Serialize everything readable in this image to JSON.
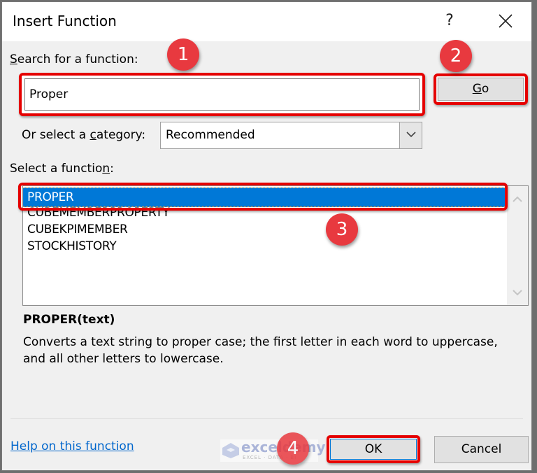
{
  "dialog": {
    "title": "Insert Function",
    "help_glyph": "?",
    "close_icon": "close-icon"
  },
  "search": {
    "label_underlined": "S",
    "label_rest": "earch for a function:",
    "value": "Proper",
    "go_label_underlined": "G",
    "go_label_rest": "o"
  },
  "category": {
    "label_prefix": "Or select a ",
    "label_underlined": "c",
    "label_rest": "ategory:",
    "selected": "Recommended",
    "arrow_icon": "chevron-down-icon"
  },
  "functions": {
    "label_prefix": "Select a functio",
    "label_underlined": "n",
    "label_rest": ":",
    "items": [
      "PROPER",
      "CUBEMEMBERPROPERTY",
      "CUBEKPIMEMBER",
      "STOCKHISTORY"
    ],
    "selected_index": 0
  },
  "details": {
    "signature": "PROPER(text)",
    "description": "Converts a text string to proper case; the first letter in each word to uppercase, and all other letters to lowercase."
  },
  "footer": {
    "help_link": "Help on this function",
    "ok_label": "OK",
    "cancel_label": "Cancel"
  },
  "watermark": {
    "name": "exceldemy",
    "tagline": "EXCEL · DATA · BI"
  },
  "annotations": {
    "step1": "1",
    "step2": "2",
    "step3": "3",
    "step4": "4",
    "highlight_color": "#e50000",
    "badge_color": "#e8393f"
  },
  "colors": {
    "selection": "#0078d7",
    "link": "#0066cc",
    "dialog_bg": "#f0f0f0"
  }
}
